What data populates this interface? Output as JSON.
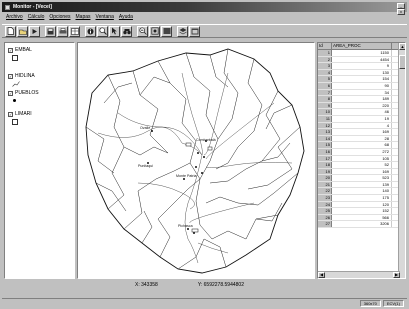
{
  "window": {
    "title": "Monitor - [Vecei]"
  },
  "window_controls": {
    "minimize": "_",
    "close": "x"
  },
  "menu": [
    "Archivo",
    "Cálculo",
    "Opciones",
    "Mapas",
    "Ventana",
    "Ayuda"
  ],
  "layers": [
    {
      "name": "EMBAL",
      "checked": true,
      "symbol": "box"
    },
    {
      "name": "HIDLINA",
      "checked": true,
      "symbol": "line"
    },
    {
      "name": "PUEBLOS",
      "checked": true,
      "symbol": "dot"
    },
    {
      "name": "LIMARI",
      "checked": true,
      "symbol": "box"
    }
  ],
  "table": {
    "headers": [
      "Id",
      "AREA_PROC"
    ],
    "rows": [
      [
        "1",
        "1150"
      ],
      [
        "2",
        "4454"
      ],
      [
        "3",
        "9"
      ],
      [
        "4",
        "130"
      ],
      [
        "5",
        "154"
      ],
      [
        "6",
        "90"
      ],
      [
        "7",
        "34"
      ],
      [
        "8",
        "189"
      ],
      [
        "9",
        "220"
      ],
      [
        "10",
        "46"
      ],
      [
        "11",
        "19"
      ],
      [
        "12",
        "4"
      ],
      [
        "13",
        "169"
      ],
      [
        "14",
        "28"
      ],
      [
        "15",
        "68"
      ],
      [
        "16",
        "272"
      ],
      [
        "17",
        "105"
      ],
      [
        "18",
        "52"
      ],
      [
        "19",
        "169"
      ],
      [
        "20",
        "523"
      ],
      [
        "21",
        "139"
      ],
      [
        "22",
        "140"
      ],
      [
        "23",
        "175"
      ],
      [
        "24",
        "120"
      ],
      [
        "25",
        "152"
      ],
      [
        "26",
        "566"
      ],
      [
        "27",
        "3206"
      ]
    ]
  },
  "coords": {
    "x_label": "X:",
    "x_value": "343358",
    "y_label": "Y:",
    "y_value": "6592278.5944802"
  },
  "status": [
    "360x70",
    "ECV(1)"
  ],
  "map_labels": [
    "Ovalle",
    "Combarbalá",
    "Punitaqui",
    "Monte Patria",
    "Pichasca"
  ]
}
